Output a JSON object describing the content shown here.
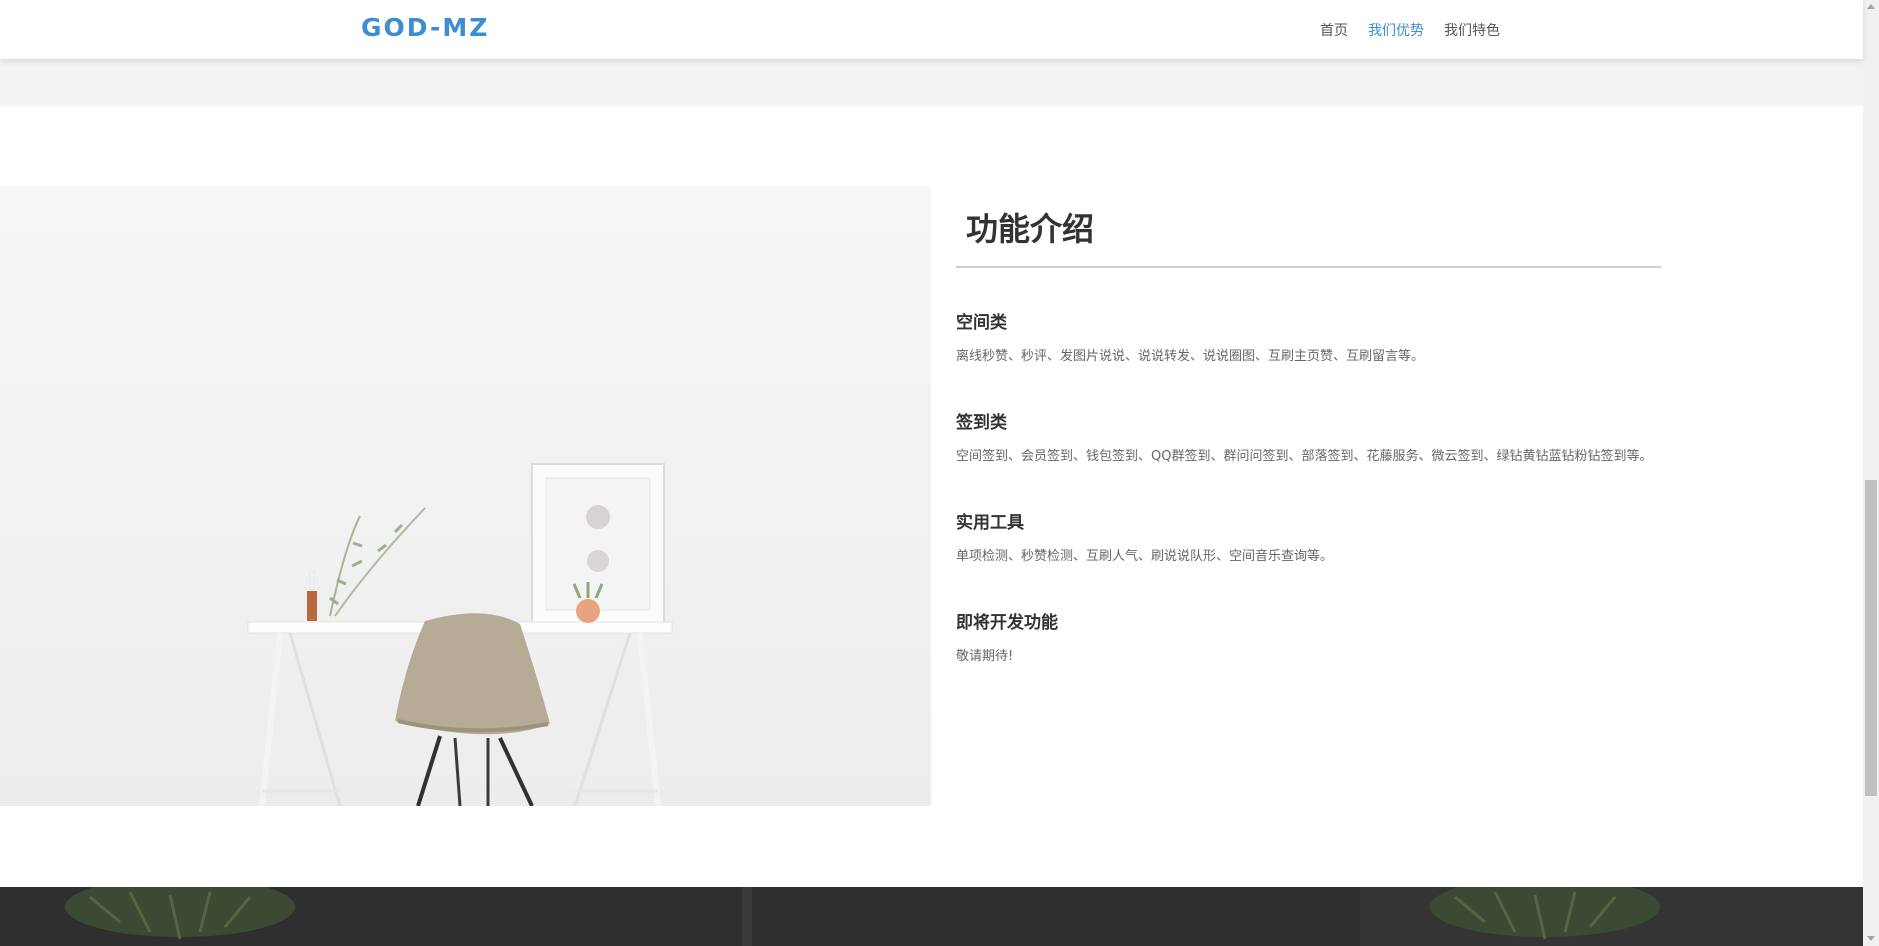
{
  "nav": {
    "brand": "GOD-MZ",
    "items": [
      {
        "label": "首页"
      },
      {
        "label": "我们优势"
      },
      {
        "label": "我们特色"
      }
    ]
  },
  "intro": {
    "title": "功能介绍",
    "features": [
      {
        "name": "空间类",
        "desc": "离线秒赞、秒评、发图片说说、说说转发、说说圈图、互刷主页赞、互刷留言等。"
      },
      {
        "name": "签到类",
        "desc": "空间签到、会员签到、钱包签到、QQ群签到、群问问签到、部落签到、花藤服务、微云签到、绿钻黄钻蓝钻粉钻签到等。"
      },
      {
        "name": "实用工具",
        "desc": "单项检测、秒赞检测、互刷人气、刷说说队形、空间音乐查询等。"
      },
      {
        "name": "即将开发功能",
        "desc": "敬请期待!"
      }
    ]
  },
  "colors": {
    "brand": "#3d8ed1",
    "text": "#333333",
    "muted": "#666666",
    "dark_band": "#2f2f30"
  },
  "icons": {
    "scroll_up": "scroll-up-arrow-icon",
    "scroll_down": "scroll-down-arrow-icon"
  }
}
